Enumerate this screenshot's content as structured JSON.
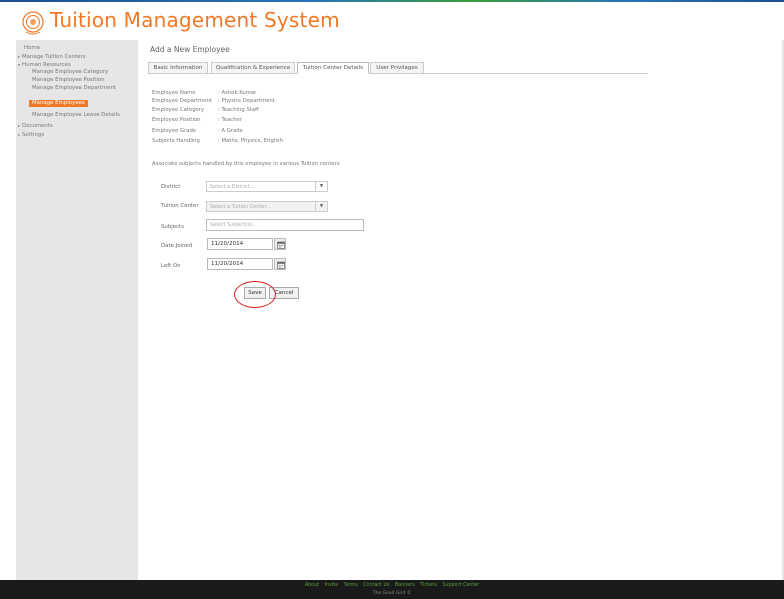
{
  "app": {
    "title": "Tuition Management System",
    "brand_color": "#f07826"
  },
  "sidebar": {
    "items": [
      {
        "label": "Home",
        "expander": ""
      },
      {
        "label": "Manage Tuition Centers",
        "expander": "▸"
      },
      {
        "label": "Human Resources",
        "expander": "▾"
      },
      {
        "label": "Manage Employee Category",
        "expander": ""
      },
      {
        "label": "Manage Employee Position",
        "expander": ""
      },
      {
        "label": "Manage Employee Department",
        "expander": ""
      },
      {
        "label": "Manage Employees",
        "expander": "",
        "active": true
      },
      {
        "label": "Manage Employee Leave Details",
        "expander": ""
      },
      {
        "label": "Documents",
        "expander": "▸"
      },
      {
        "label": "Settings",
        "expander": "▸"
      }
    ]
  },
  "main": {
    "page_title": "Add a New Employee",
    "tabs": [
      {
        "label": "Basic Information"
      },
      {
        "label": "Qualification & Experience"
      },
      {
        "label": "Tuition Center Details",
        "active": true
      },
      {
        "label": "User Privilages"
      }
    ],
    "employee_info": [
      {
        "label": "Employee Name",
        "value": ": Ashok Kumar"
      },
      {
        "label": "Employee Department",
        "value": ": Physics Department"
      },
      {
        "label": "Employee Category",
        "value": ": Teaching Staff"
      },
      {
        "label": "Employee Position",
        "value": ": Teacher"
      },
      {
        "label": "Employee Grade",
        "value": ": A Grade"
      },
      {
        "label": "Subjects Handling",
        "value": ": Maths, Physics, English"
      }
    ],
    "section_note": "Associate subjects handled by this employee in various Tuition centers",
    "form": {
      "district": {
        "label": "District",
        "placeholder": "Select a District..."
      },
      "tuition_center": {
        "label": "Tuition Center",
        "placeholder": "Select a Tuition Center..."
      },
      "subjects": {
        "label": "Subjects",
        "placeholder": "Select Subject(s)..."
      },
      "date_joined": {
        "label": "Date Joined",
        "value": "11/20/2014"
      },
      "left_on": {
        "label": "Left On",
        "value": "11/20/2014"
      }
    },
    "buttons": {
      "save": "Save",
      "cancel": "Cancel"
    }
  },
  "footer": {
    "links": [
      "About",
      "Invite",
      "Terms",
      "Contact Us",
      "Banners",
      "Tickets",
      "Support Center"
    ],
    "copyright": "The Good Grid ©"
  },
  "icons": {
    "logo": "logo-emblem-icon",
    "calendar": "calendar-icon",
    "dropdown": "chevron-down-icon"
  }
}
